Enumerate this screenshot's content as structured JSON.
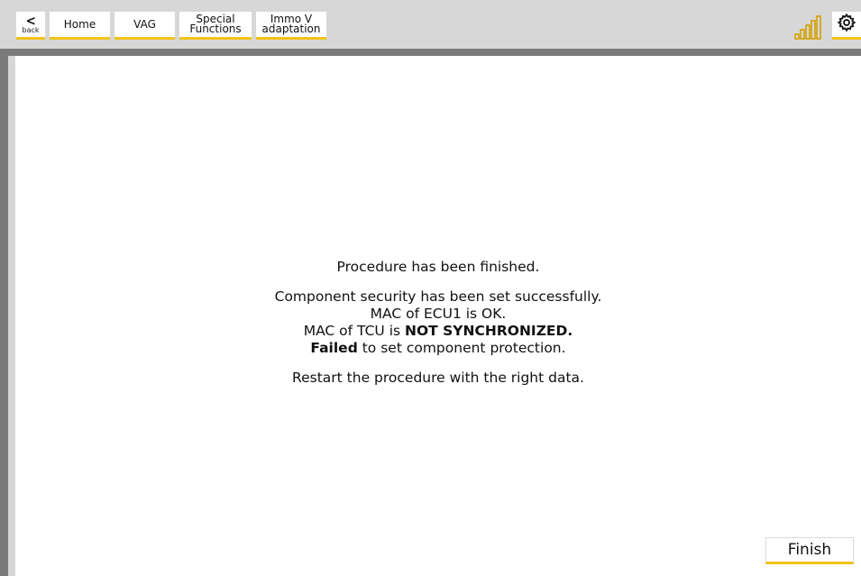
{
  "toolbar": {
    "back_label": "back",
    "breadcrumbs": [
      {
        "label": "Home"
      },
      {
        "label": "VAG"
      },
      {
        "label": "Special\nFunctions"
      },
      {
        "label": "Immo V\nadaptation"
      }
    ],
    "signal_icon": "signal-strength-icon",
    "settings_icon": "gear-icon"
  },
  "message": {
    "line1": "Procedure has been finished.",
    "line2": "Component security has been set successfully.",
    "line3": "MAC of ECU1 is OK.",
    "line4_prefix": "MAC of TCU is ",
    "line4_bold": "NOT SYNCHRONIZED.",
    "line5_bold": "Failed",
    "line5_suffix": " to set component protection.",
    "line6": "Restart the procedure with the right data."
  },
  "actions": {
    "finish_label": "Finish"
  },
  "colors": {
    "accent": "#f0c419",
    "toolbar_bg": "#d7d7d7",
    "divider": "#7a7a7a"
  }
}
